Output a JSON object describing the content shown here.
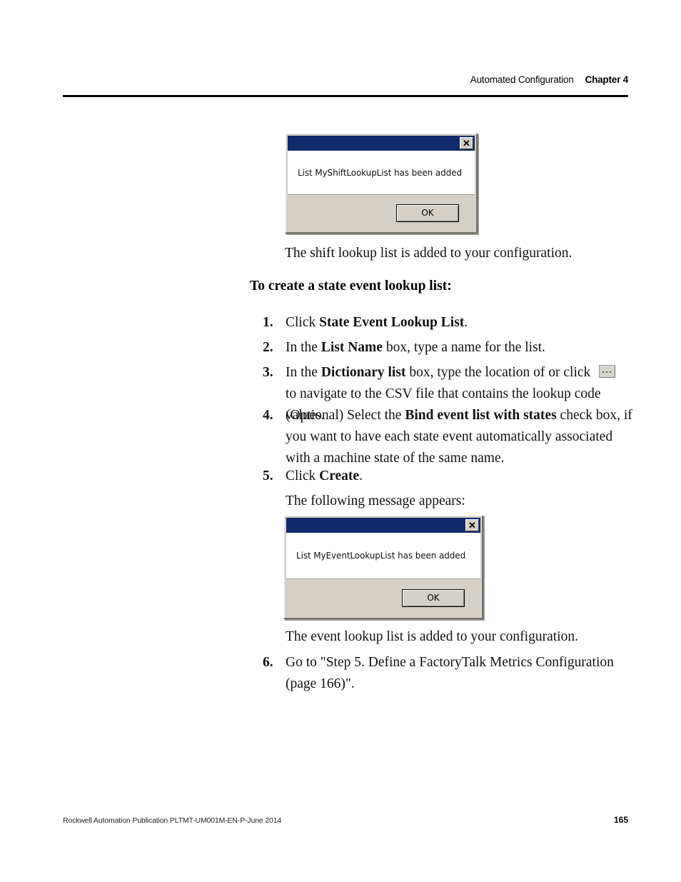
{
  "header": {
    "chapter_title": "Automated Configuration",
    "chapter_number": "Chapter 4"
  },
  "dialog_shift": {
    "message": "List MyShiftLookupList has been added",
    "ok_label": "OK",
    "close_label": "✕",
    "titlebar_color": "#0f2a6b",
    "face_color": "#d4d0c8"
  },
  "dialog_event": {
    "message": "List MyEventLookupList has been added",
    "ok_label": "OK",
    "close_label": "✕",
    "titlebar_color": "#0f2a6b",
    "face_color": "#d4d0c8"
  },
  "body": {
    "after_shift_dialog": "The shift lookup list is added to your configuration.",
    "section_heading": "To create a state event lookup list:",
    "after_step5": "The following message appears:",
    "after_event_dialog": "The event lookup list is added to your configuration."
  },
  "steps": [
    {
      "num": "1.",
      "pre": "Click ",
      "bold": "State Event Lookup List",
      "post": "."
    },
    {
      "num": "2.",
      "pre": "In the ",
      "bold": "List Name",
      "post": " box, type a name for the list."
    },
    {
      "num": "3.",
      "pre": "In the ",
      "bold": "Dictionary list",
      "mid": " box, type the location of or click ",
      "post": " to navigate to the CSV file that contains the lookup code values."
    },
    {
      "num": "4.",
      "pre": "(Optional) Select the ",
      "bold": "Bind event list with states",
      "post": " check box, if you want to have each state event automatically associated with a machine state of the same name."
    },
    {
      "num": "5.",
      "pre": "Click ",
      "bold": "Create",
      "post": "."
    },
    {
      "num": "6.",
      "pre": "Go to \"Step 5. Define a FactoryTalk Metrics Configuration (page 166)\".",
      "bold": "",
      "post": ""
    }
  ],
  "footer": {
    "publication": "Rockwell Automation Publication PLTMT-UM001M-EN-P-June 2014",
    "page_number": "165"
  }
}
